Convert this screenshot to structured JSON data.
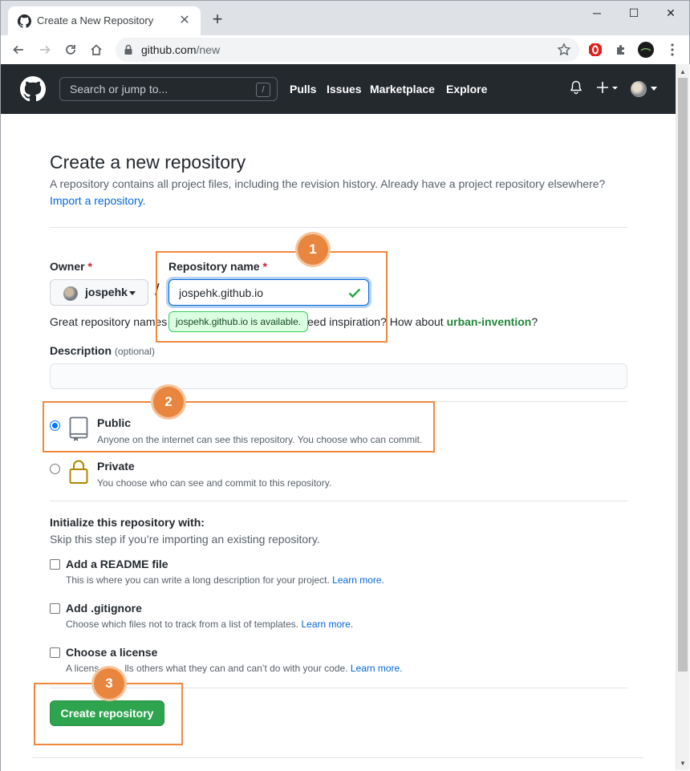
{
  "browser": {
    "tab_title": "Create a New Repository",
    "url_host": "github.com",
    "url_path": "/new",
    "new_tab_glyph": "+",
    "close_glyph": "✕",
    "minimize_glyph": "─",
    "maximize_glyph": "☐",
    "window_close_glyph": "✕"
  },
  "github_header": {
    "search_placeholder": "Search or jump to...",
    "search_shortcut": "/",
    "nav": [
      "Pulls",
      "Issues",
      "Marketplace",
      "Explore"
    ]
  },
  "page": {
    "title": "Create a new repository",
    "subtitle": "A repository contains all project files, including the revision history. Already have a project repository elsewhere?",
    "import_link": "Import a repository."
  },
  "form": {
    "owner_label": "Owner",
    "required_mark": "*",
    "owner_value": "jospehk",
    "separator": "/",
    "repo_name_label": "Repository name",
    "repo_name_value": "jospehk.github.io",
    "availability": "jospehk.github.io is available.",
    "great_names_left": "Great repository names",
    "great_names_right": "eed inspiration? How about",
    "suggestion": "urban-invention",
    "suggestion_end": "?",
    "description_label": "Description",
    "description_optional": "(optional)",
    "description_value": ""
  },
  "visibility": {
    "public_title": "Public",
    "public_desc": "Anyone on the internet can see this repository. You choose who can commit.",
    "private_title": "Private",
    "private_desc": "You choose who can see and commit to this repository.",
    "selected": "public"
  },
  "init": {
    "title": "Initialize this repository with:",
    "subtitle": "Skip this step if you’re importing an existing repository.",
    "learn_more": "Learn more.",
    "options": [
      {
        "title": "Add a README file",
        "desc": "This is where you can write a long description for your project."
      },
      {
        "title": "Add .gitignore",
        "desc": "Choose which files not to track from a list of templates."
      },
      {
        "title": "Choose a license",
        "desc_a": "A licens",
        "desc_b": "lls others what they can and can’t do with your code."
      }
    ]
  },
  "submit_label": "Create repository",
  "annotations": [
    "1",
    "2",
    "3"
  ],
  "colors": {
    "annotation": "#f0883e",
    "primary_button": "#2ea44f",
    "link": "#0366d6",
    "header_bg": "#24292e"
  }
}
